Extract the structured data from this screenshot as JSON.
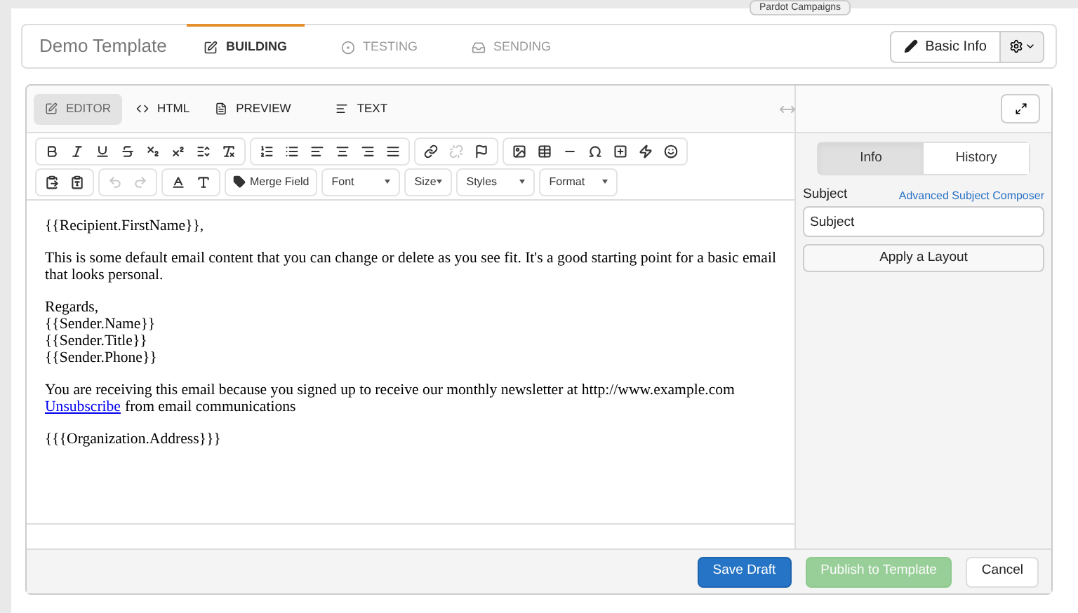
{
  "tooltip": "Pardot Campaigns",
  "header": {
    "title": "Demo Template",
    "tabs": [
      {
        "label": "BUILDING",
        "kind": "build",
        "selected": true
      },
      {
        "label": "TESTING",
        "kind": "test",
        "selected": false
      },
      {
        "label": "SENDING",
        "kind": "send",
        "selected": false
      }
    ],
    "basic_info_button": "Basic Info"
  },
  "editor_tabs": [
    {
      "label": "EDITOR",
      "kind": "editor",
      "selected": true
    },
    {
      "label": "HTML",
      "kind": "html",
      "selected": false
    },
    {
      "label": "PREVIEW",
      "kind": "preview",
      "selected": false
    },
    {
      "label": "TEXT",
      "kind": "text",
      "selected": false
    }
  ],
  "toolbar_rows": [
    [
      [
        {
          "kind": "bold",
          "disabled": false
        },
        {
          "kind": "italic",
          "disabled": false
        },
        {
          "kind": "underline",
          "disabled": false
        },
        {
          "kind": "strike",
          "disabled": false
        },
        {
          "kind": "subscript",
          "disabled": false
        },
        {
          "kind": "superscript",
          "disabled": false
        },
        {
          "kind": "lineheight",
          "disabled": false
        },
        {
          "kind": "clear",
          "disabled": false
        }
      ],
      [
        {
          "kind": "ol",
          "disabled": false
        },
        {
          "kind": "ul",
          "disabled": false
        },
        {
          "kind": "left",
          "disabled": false
        },
        {
          "kind": "center",
          "disabled": false
        },
        {
          "kind": "right",
          "disabled": false
        },
        {
          "kind": "justify",
          "disabled": false
        }
      ],
      [
        {
          "kind": "link",
          "disabled": false
        },
        {
          "kind": "unlink",
          "disabled": true
        },
        {
          "kind": "flag",
          "disabled": false
        }
      ],
      [
        {
          "kind": "image",
          "disabled": false
        },
        {
          "kind": "table",
          "disabled": false
        },
        {
          "kind": "hr",
          "disabled": false
        },
        {
          "kind": "omega",
          "disabled": false
        },
        {
          "kind": "plus",
          "disabled": false
        },
        {
          "kind": "bolt",
          "disabled": false
        },
        {
          "kind": "smile",
          "disabled": false
        }
      ]
    ],
    [
      [
        {
          "kind": "paste",
          "disabled": false
        },
        {
          "kind": "pastetext",
          "disabled": false
        }
      ],
      [
        {
          "kind": "undo",
          "disabled": true
        },
        {
          "kind": "redo",
          "disabled": true
        }
      ],
      [
        {
          "kind": "textcolor",
          "disabled": false
        },
        {
          "kind": "bgcolor",
          "disabled": false
        }
      ]
    ]
  ],
  "merge_field_button": "Merge Field",
  "dropdowns": [
    "Font",
    "Size",
    "Styles",
    "Format"
  ],
  "content": [
    [
      {
        "kind": "text",
        "text": "{{Recipient.FirstName}},"
      }
    ],
    [
      {
        "kind": "text",
        "text": "This is some default email content that you can change or delete as you see fit. It's a good starting point for a basic email that looks personal."
      }
    ],
    [
      {
        "kind": "text",
        "text": "Regards,"
      },
      {
        "kind": "text",
        "text": "{{Sender.Name}}"
      },
      {
        "kind": "text",
        "text": "{{Sender.Title}}"
      },
      {
        "kind": "text",
        "text": "{{Sender.Phone}}"
      }
    ],
    [
      {
        "kind": "text",
        "text": "You are receiving this email because you signed up to receive our monthly newsletter at http://www.example.com"
      },
      {
        "kind": "link",
        "link": "Unsubscribe",
        "text": "from email communications"
      }
    ],
    [
      {
        "kind": "text",
        "text": "{{{Organization.Address}}}"
      }
    ]
  ],
  "side_tabs": [
    {
      "label": "Info",
      "selected": true
    },
    {
      "label": "History",
      "selected": false
    }
  ],
  "subject": {
    "label": "Subject",
    "link": "Advanced Subject Composer",
    "value": "Subject"
  },
  "apply_layout_button": "Apply a Layout",
  "footer_buttons": [
    {
      "label": "Save Draft",
      "kind": "primary",
      "disabled": false
    },
    {
      "label": "Publish to Template",
      "kind": "success",
      "disabled": true
    },
    {
      "label": "Cancel",
      "kind": "default",
      "disabled": false
    }
  ]
}
